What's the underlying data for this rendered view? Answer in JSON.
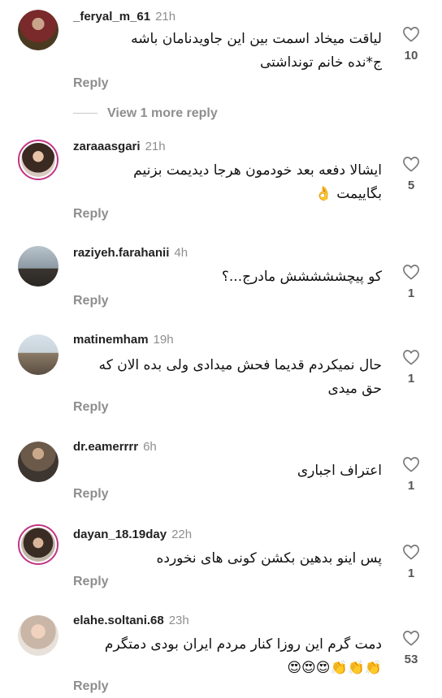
{
  "comments": [
    {
      "username": "_feryal_m_61",
      "time": "21h",
      "text_line1": "لیاقت میخاد اسمت  بین این جاویدنامان باشه",
      "text_line2": "ج*نده خانم تونداشتی",
      "reply_label": "Reply",
      "likes": "10"
    },
    {
      "username": "zaraaasgari",
      "time": "21h",
      "text_line1": "ایشالا دفعه بعد خودمون هرجا دیدیمت بزنیم",
      "text_line2": "بگاییمت 👌",
      "reply_label": "Reply",
      "likes": "5"
    },
    {
      "username": "raziyeh.farahanii",
      "time": "4h",
      "text_line1": "کو پیچششششش مادرج...؟",
      "reply_label": "Reply",
      "likes": "1"
    },
    {
      "username": "matinemham",
      "time": "19h",
      "text_line1": "حال نمیکردم قدیما فحش میدادی ولی بده الان که",
      "text_line2": "حق میدی",
      "reply_label": "Reply",
      "likes": "1"
    },
    {
      "username": "dr.eamerrrr",
      "time": "6h",
      "text_line1": "اعتراف اجباری",
      "reply_label": "Reply",
      "likes": "1"
    },
    {
      "username": "dayan_18.19day",
      "time": "22h",
      "text_line1": "پس اینو بدهین بکشن کونی های نخورده",
      "reply_label": "Reply",
      "likes": "1"
    },
    {
      "username": "elahe.soltani.68",
      "time": "23h",
      "text_line1": "دمت گرم  این  روزا  کنار  مردم ایران بودی  دمتگرم",
      "text_line2": "👏👏👏😍😍😍",
      "reply_label": "Reply",
      "likes": "53"
    }
  ],
  "view_more_label": "View 1 more reply",
  "icons": {
    "like": "heart-outline-icon"
  },
  "colors": {
    "muted": "#8e8e8e",
    "story_ring": "#c13584"
  }
}
